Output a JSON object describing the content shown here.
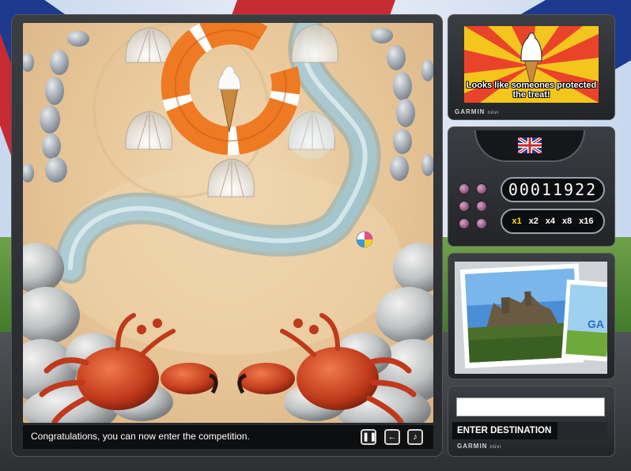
{
  "info_panel": {
    "message": "Looks like someones protected the treat!",
    "brand": "GARMIN",
    "brand_sub": "nüvi"
  },
  "score_panel": {
    "score": "00011922",
    "multipliers": [
      "x1",
      "x2",
      "x4",
      "x8",
      "x16"
    ],
    "active_multiplier": "x1",
    "lives": 6
  },
  "destination": {
    "input_value": "",
    "label": "ENTER DESTINATION",
    "brand": "GARMIN",
    "brand_sub": "nüvi"
  },
  "status": {
    "message": "Congratulations, you can now enter the competition."
  },
  "controls": {
    "pause_icon": "pause-icon",
    "back_icon": "arrow-left-icon",
    "music_icon": "music-note-icon"
  },
  "photo": {
    "overlay_text": "GA"
  },
  "colors": {
    "active_multiplier": "#ffe000",
    "info_background": "#f4c51c",
    "lifebuoy": "#ef7a24"
  }
}
